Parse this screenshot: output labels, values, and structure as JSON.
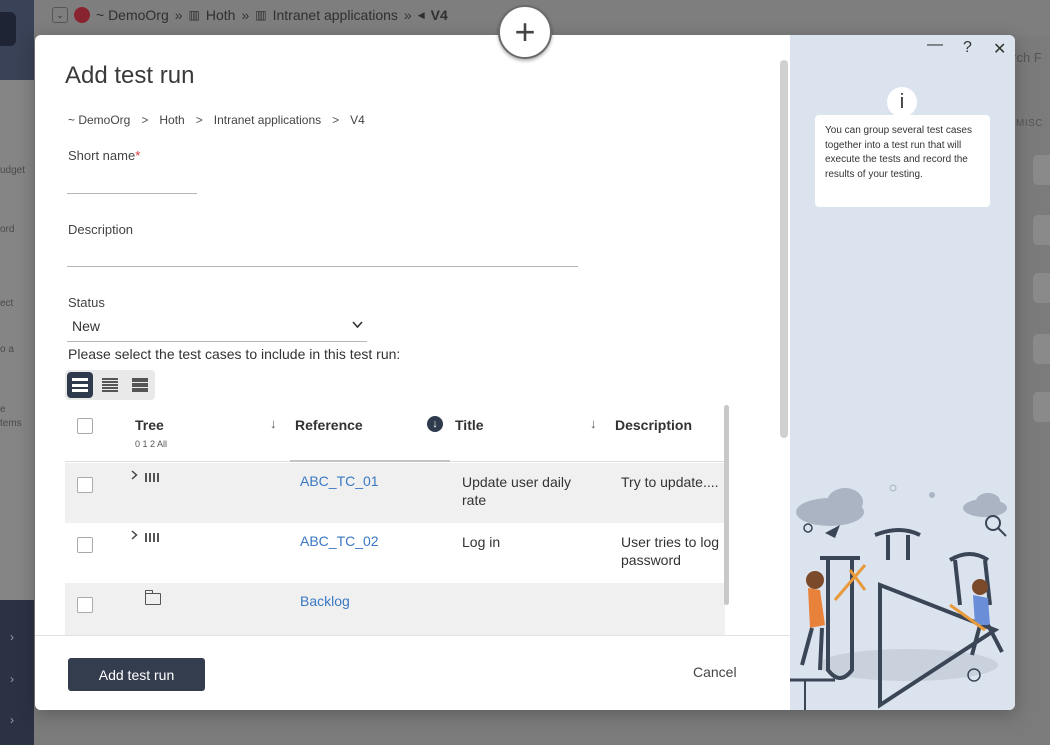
{
  "background": {
    "breadcrumb": [
      "~ DemoOrg",
      "Hoth",
      "Intranet applications",
      "V4"
    ],
    "breadcrumb_separator": "»",
    "search_placeholder": "arch F",
    "misc_label": "MISC",
    "side_labels": [
      "udget",
      "ord",
      "ect",
      "o a",
      "e",
      "tems"
    ]
  },
  "modal": {
    "title": "Add test run",
    "breadcrumb": [
      "~ DemoOrg",
      "Hoth",
      "Intranet applications",
      "V4"
    ],
    "breadcrumb_separator": ">",
    "fields": {
      "short_name_label": "Short name",
      "required_marker": "*",
      "short_name_value": "",
      "description_label": "Description",
      "description_value": "",
      "status_label": "Status",
      "status_value": "New"
    },
    "select_prompt": "Please select the test cases to include in this test run:",
    "grid": {
      "columns": {
        "tree": "Tree",
        "tree_levels": "0 1 2 All",
        "reference": "Reference",
        "title": "Title",
        "description": "Description"
      },
      "rows": [
        {
          "reference": "ABC_TC_01",
          "title": "Update user daily rate",
          "description": "Try to update....",
          "kind": "test-case"
        },
        {
          "reference": "ABC_TC_02",
          "title": "Log in",
          "description": "User tries to log password",
          "kind": "test-case"
        },
        {
          "reference": "Backlog",
          "title": "",
          "description": "",
          "kind": "folder"
        }
      ]
    },
    "footer": {
      "primary_label": "Add test run",
      "cancel_label": "Cancel"
    },
    "side_panel": {
      "info_icon": "i",
      "info_text": "You can group several test cases together into a test run that will execute the tests and record the results of your testing.",
      "controls": {
        "minimize": "—",
        "help": "?",
        "close": "✕"
      }
    }
  },
  "colors": {
    "primary": "#343d4e",
    "link": "#3a78c3",
    "required": "#dd3333",
    "side_panel": "#dbe3ee"
  }
}
